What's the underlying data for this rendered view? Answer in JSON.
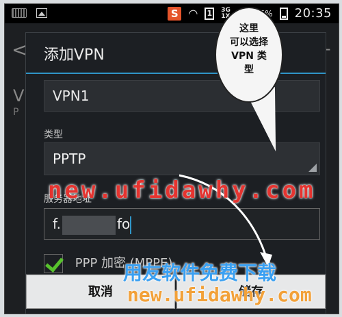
{
  "status_bar": {
    "time": "20:35",
    "battery_percent": "15%",
    "sim_slot": "1",
    "network_type_top": "3G",
    "network_type_bottom": "1X",
    "app_badge": "S"
  },
  "background_app": {
    "back_glyph": "<",
    "plus_glyph": "+",
    "row_letter": "V",
    "row_sub": "P"
  },
  "dialog": {
    "title": "添加VPN",
    "name_value": "VPN1",
    "type_label": "类型",
    "type_value": "PPTP",
    "server_label": "服务器地址",
    "server_prefix": "f.",
    "server_suffix": "fo",
    "ppp_label": "PPP 加密 (MPPE)",
    "cancel_label": "取消",
    "save_label": "储存"
  },
  "callout": {
    "line1": "这里",
    "line2": "可以选择",
    "line3": "VPN 类",
    "line4": "型"
  },
  "watermark": {
    "url_red": "new.ufidawhy.com",
    "slogan": "用友软件免费下载",
    "url_orange": "new.ufidawhy.com"
  },
  "colors": {
    "accent": "#2f95c7",
    "check": "#58c22d",
    "watermark_red": "#e53430",
    "watermark_blue": "#3aa0f2",
    "watermark_orange": "#f2a13a"
  }
}
